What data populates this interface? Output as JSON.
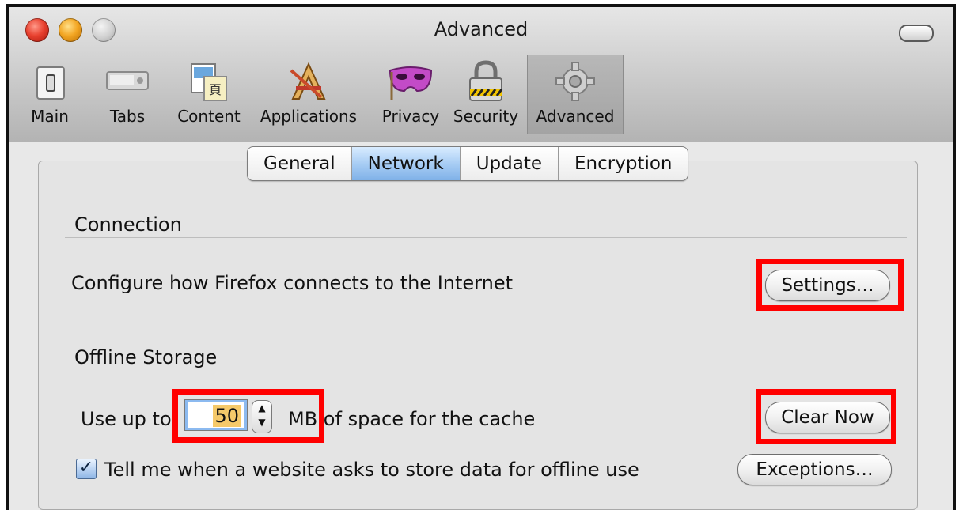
{
  "window": {
    "title": "Advanced"
  },
  "toolbar": {
    "items": [
      {
        "label": "Main",
        "icon": "switch-icon"
      },
      {
        "label": "Tabs",
        "icon": "tabs-icon"
      },
      {
        "label": "Content",
        "icon": "content-icon"
      },
      {
        "label": "Applications",
        "icon": "applications-icon"
      },
      {
        "label": "Privacy",
        "icon": "mask-icon"
      },
      {
        "label": "Security",
        "icon": "lock-icon"
      },
      {
        "label": "Advanced",
        "icon": "gear-icon"
      }
    ],
    "selected": "Advanced"
  },
  "tabs": {
    "items": [
      "General",
      "Network",
      "Update",
      "Encryption"
    ],
    "active": "Network"
  },
  "connection": {
    "heading": "Connection",
    "description": "Configure how Firefox connects to the Internet",
    "settings_button": "Settings…"
  },
  "offline": {
    "heading": "Offline Storage",
    "cache_prefix": "Use up to",
    "cache_value": "50",
    "cache_suffix": "MB of space for the cache",
    "clear_button": "Clear Now",
    "notify_label": "Tell me when a website asks to store data for offline use",
    "notify_checked": true,
    "exceptions_button": "Exceptions…"
  },
  "colors": {
    "highlight": "#ff0000",
    "active_tab": "#a8cdf4"
  }
}
